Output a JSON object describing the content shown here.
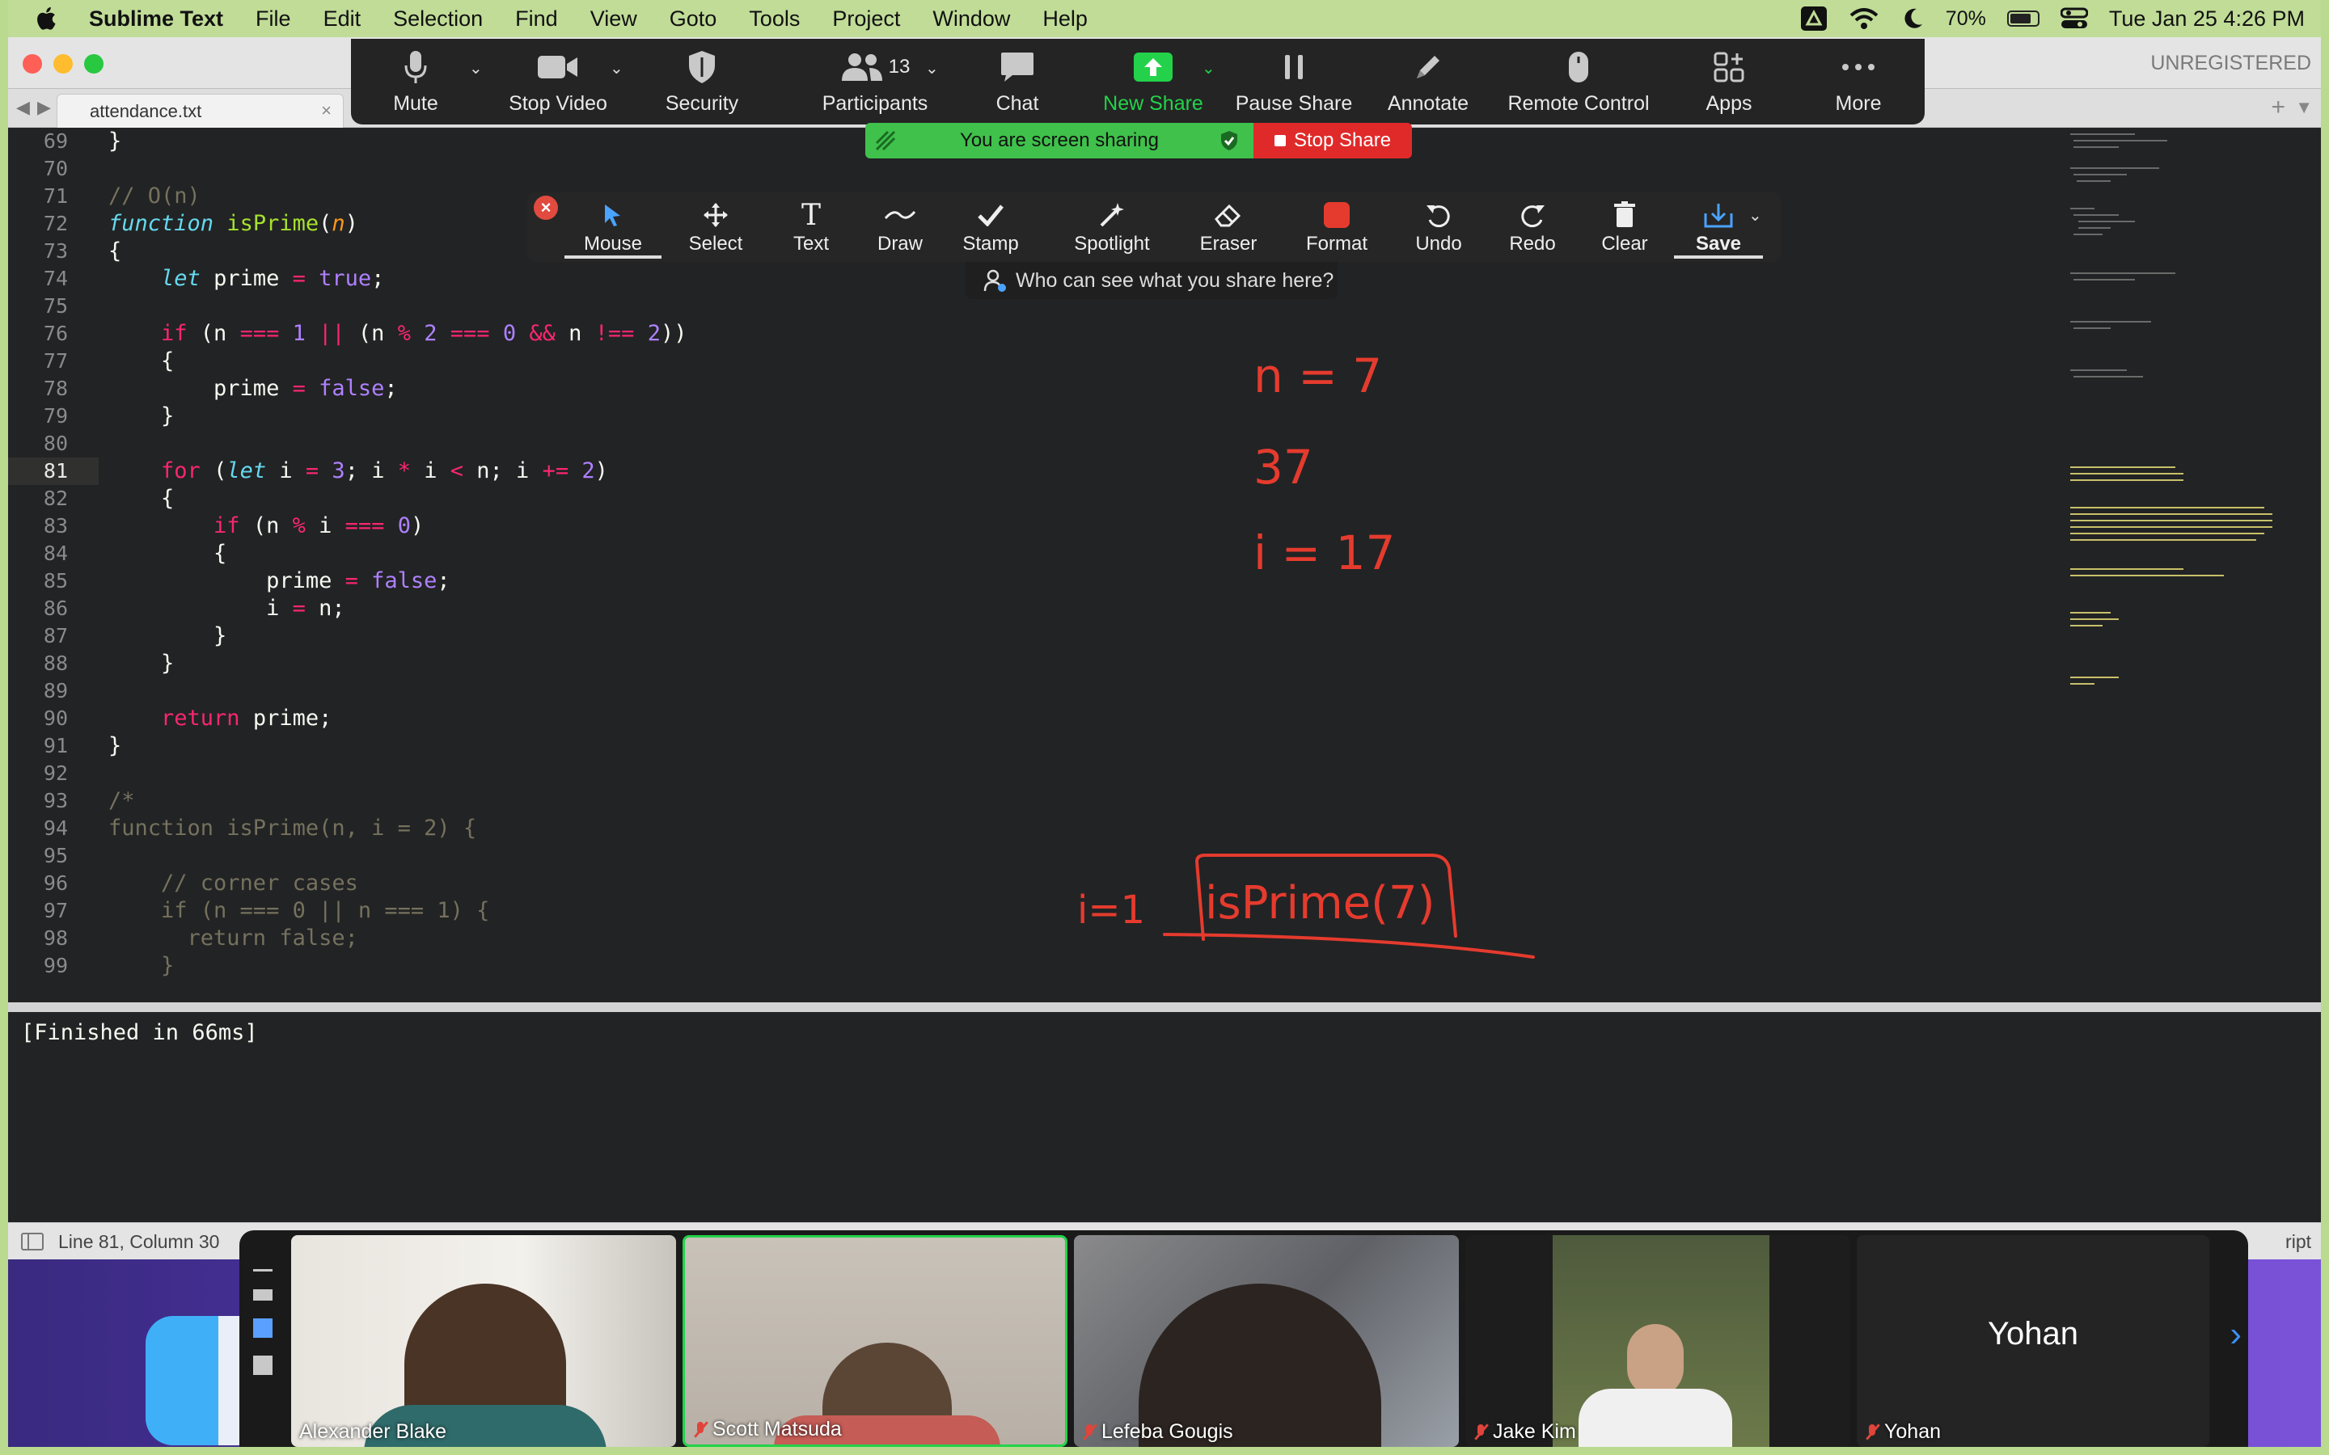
{
  "menubar": {
    "app_name": "Sublime Text",
    "items": [
      "File",
      "Edit",
      "Selection",
      "Find",
      "View",
      "Goto",
      "Tools",
      "Project",
      "Window",
      "Help"
    ],
    "battery": "70%",
    "datetime": "Tue Jan 25  4:26 PM"
  },
  "window": {
    "unregistered": "UNREGISTERED",
    "tab_label": "attendance.txt"
  },
  "zoom_toolbar": {
    "mute": "Mute",
    "stop_video": "Stop Video",
    "security": "Security",
    "participants_count": "13",
    "participants": "Participants",
    "chat": "Chat",
    "new_share": "New Share",
    "pause_share": "Pause Share",
    "annotate": "Annotate",
    "remote_control": "Remote Control",
    "apps": "Apps",
    "more": "More"
  },
  "share_bar": {
    "status": "You are screen sharing",
    "stop": "Stop Share"
  },
  "annotate_toolbar": {
    "mouse": "Mouse",
    "select": "Select",
    "text": "Text",
    "draw": "Draw",
    "stamp": "Stamp",
    "spotlight": "Spotlight",
    "eraser": "Eraser",
    "format": "Format",
    "undo": "Undo",
    "redo": "Redo",
    "clear": "Clear",
    "save": "Save",
    "who_can_see": "Who can see what you share here?"
  },
  "editor": {
    "line_numbers": [
      "69",
      "70",
      "71",
      "72",
      "73",
      "74",
      "75",
      "76",
      "77",
      "78",
      "79",
      "80",
      "81",
      "82",
      "83",
      "84",
      "85",
      "86",
      "87",
      "88",
      "89",
      "90",
      "91",
      "92",
      "93",
      "94",
      "95",
      "96",
      "97",
      "98",
      "99"
    ],
    "current_line": "81"
  },
  "annotations": {
    "n_eq": "n = 7",
    "num": "37",
    "i_eq": "i = 17",
    "i1": "i=1",
    "boxed": "isPrime(7)"
  },
  "output": {
    "text": "[Finished in 66ms]"
  },
  "statusbar": {
    "position": "Line 81, Column 30",
    "syntax": "ript"
  },
  "participants": [
    {
      "name": "Alexander Blake"
    },
    {
      "name": "Scott Matsuda"
    },
    {
      "name": "Lefeba Gougis"
    },
    {
      "name": "Jake Kim"
    },
    {
      "name": "Yohan",
      "display": "Yohan"
    }
  ],
  "colors": {
    "desktop_border": "#b9da8f",
    "zoom_green": "#23d24a",
    "stop_red": "#e02a2a",
    "annotation_red": "#e53b2e",
    "editor_bg": "#222324"
  }
}
